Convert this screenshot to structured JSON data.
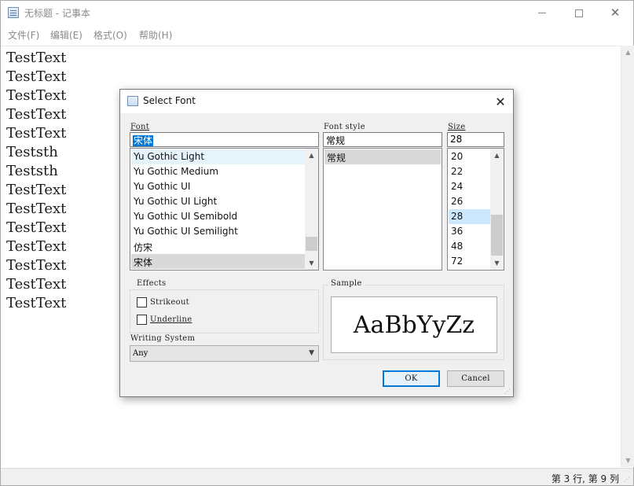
{
  "window": {
    "title": "无标题 - 记事本",
    "menu": [
      "文件(F)",
      "编辑(E)",
      "格式(O)",
      "帮助(H)"
    ],
    "editor_lines": [
      "TestText",
      "TestText",
      "TestText",
      "TestText",
      "TestText",
      "Teststh",
      "Teststh",
      "TestText",
      "TestText",
      "TestText",
      "TestText",
      "TestText",
      "TestText",
      "TestText"
    ],
    "status": "第 3 行, 第 9 列"
  },
  "dialog": {
    "title": "Select Font",
    "font_label": "Font",
    "font_value": "宋体",
    "font_list": [
      "Yu Gothic Light",
      "Yu Gothic Medium",
      "Yu Gothic UI",
      "Yu Gothic UI Light",
      "Yu Gothic UI Semibold",
      "Yu Gothic UI Semilight",
      "仿宋",
      "宋体"
    ],
    "style_label": "Font style",
    "style_value": "常规",
    "style_list": [
      "常规"
    ],
    "size_label": "Size",
    "size_value": "28",
    "size_list": [
      "20",
      "22",
      "24",
      "26",
      "28",
      "36",
      "48",
      "72"
    ],
    "effects_label": "Effects",
    "strikeout_label": "Strikeout",
    "underline_label": "Underline",
    "writing_system_label": "Writing System",
    "writing_system_value": "Any",
    "sample_label": "Sample",
    "sample_text": "AaBbYyZz",
    "ok_label": "OK",
    "cancel_label": "Cancel"
  }
}
